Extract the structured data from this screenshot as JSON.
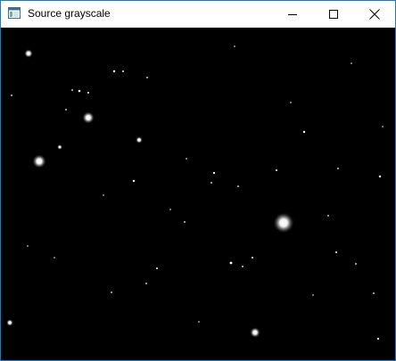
{
  "window": {
    "title": "Source grayscale",
    "app_icon": "app-window-icon",
    "controls": [
      "minimize-icon",
      "maximize-icon",
      "close-icon"
    ]
  },
  "colors": {
    "titlebar_bg": "#ffffff",
    "window_border": "#1979ca",
    "image_bg": "#000000",
    "star": "#ffffff"
  }
}
